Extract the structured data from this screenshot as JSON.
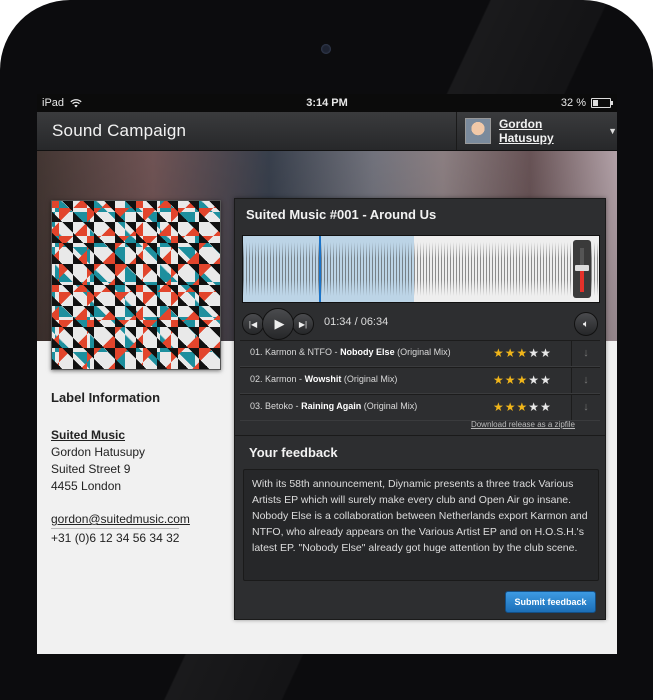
{
  "status_bar": {
    "device": "iPad",
    "time": "3:14 PM",
    "battery": "32 %",
    "battery_level": 0.32
  },
  "header": {
    "title": "Sound Campaign",
    "user_name": "Gordon Hatusupy"
  },
  "label_info": {
    "heading": "Label Information",
    "company": "Suited Music",
    "contact": "Gordon Hatusupy",
    "street": "Suited Street 9",
    "city": "4455 London",
    "email": "gordon@suitedmusic.com",
    "phone": "+31 (0)6 12 34 56 34 32"
  },
  "player": {
    "release_title": "Suited Music #001 - Around Us",
    "time": "01:34 / 06:34",
    "progress": 0.24,
    "volume": 0.55
  },
  "tracks": [
    {
      "number": "01.",
      "artist": "Karmon & NTFO -",
      "title": "Nobody Else",
      "mix": "(Original Mix)",
      "rating": 3,
      "max_rating": 5
    },
    {
      "number": "02.",
      "artist": "Karmon -",
      "title": "Wowshit",
      "mix": "(Original Mix)",
      "rating": 3,
      "max_rating": 5
    },
    {
      "number": "03.",
      "artist": "Betoko -",
      "title": "Raining Again",
      "mix": "(Original Mix)",
      "rating": 3,
      "max_rating": 5
    }
  ],
  "download_link": "Download release as a zipfile",
  "feedback": {
    "heading": "Your feedback",
    "text": "With its 58th announcement, Diynamic presents a three track Various Artists EP which will surely make every club and Open Air go insane. Nobody Else is a collaboration between Netherlands export Karmon and NTFO, who already appears on the Various Artist EP and on H.O.S.H.'s latest EP. \"Nobody Else\" already got huge attention by the club scene.",
    "submit_label": "Submit feedback"
  },
  "icons": {
    "wifi": "wifi-icon",
    "caret": "chevron-down-icon",
    "prev": "skip-back-icon",
    "play": "play-icon",
    "next": "skip-forward-icon",
    "volume": "speaker-icon",
    "download": "download-arrow-icon"
  },
  "colors": {
    "accent_blue": "#1c6fb8",
    "star": "#f0b51a",
    "volume_red": "#e4312a",
    "panel": "#2d2e30"
  }
}
